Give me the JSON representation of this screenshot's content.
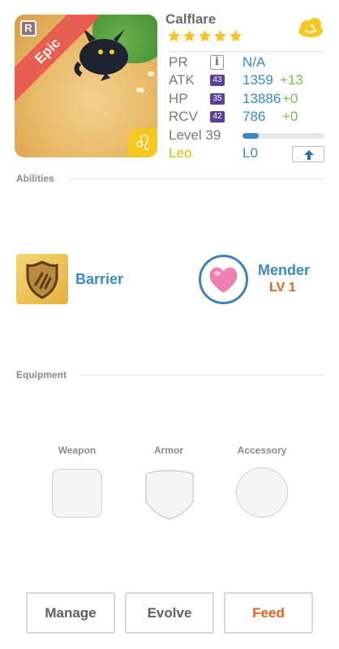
{
  "monster": {
    "name": "Calflare",
    "rarity": "Epic",
    "rank_badge": "R",
    "stars": 5,
    "element_icon": "cloud-element-icon",
    "zodiac_glyph": "♌"
  },
  "stats": {
    "pr": {
      "label": "PR",
      "value": "N/A"
    },
    "atk": {
      "label": "ATK",
      "level": "43",
      "value": "1359",
      "bonus": "+13"
    },
    "hp": {
      "label": "HP",
      "level": "35",
      "value": "13886",
      "bonus": "+0"
    },
    "rcv": {
      "label": "RCV",
      "level": "42",
      "value": "786",
      "bonus": "+0"
    },
    "level": {
      "label": "Level 39",
      "progress": 0.2
    },
    "sign": {
      "label": "Leo",
      "value": "L0"
    }
  },
  "sections": {
    "abilities": "Abilities",
    "equipment": "Equipment"
  },
  "abilities": [
    {
      "name": "Barrier",
      "icon": "shield-icon"
    },
    {
      "name": "Mender",
      "level": "LV 1",
      "icon": "heart-icon"
    }
  ],
  "equipment": {
    "weapon": "Weapon",
    "armor": "Armor",
    "accessory": "Accessory"
  },
  "actions": {
    "manage": "Manage",
    "evolve": "Evolve",
    "feed": "Feed"
  },
  "colors": {
    "accent_blue": "#3b8ac4",
    "bonus_green": "#7bbf4a",
    "feed_orange": "#e5611f",
    "epic_red": "#e8564f",
    "level_badge_purple": "#5b3f9e"
  }
}
